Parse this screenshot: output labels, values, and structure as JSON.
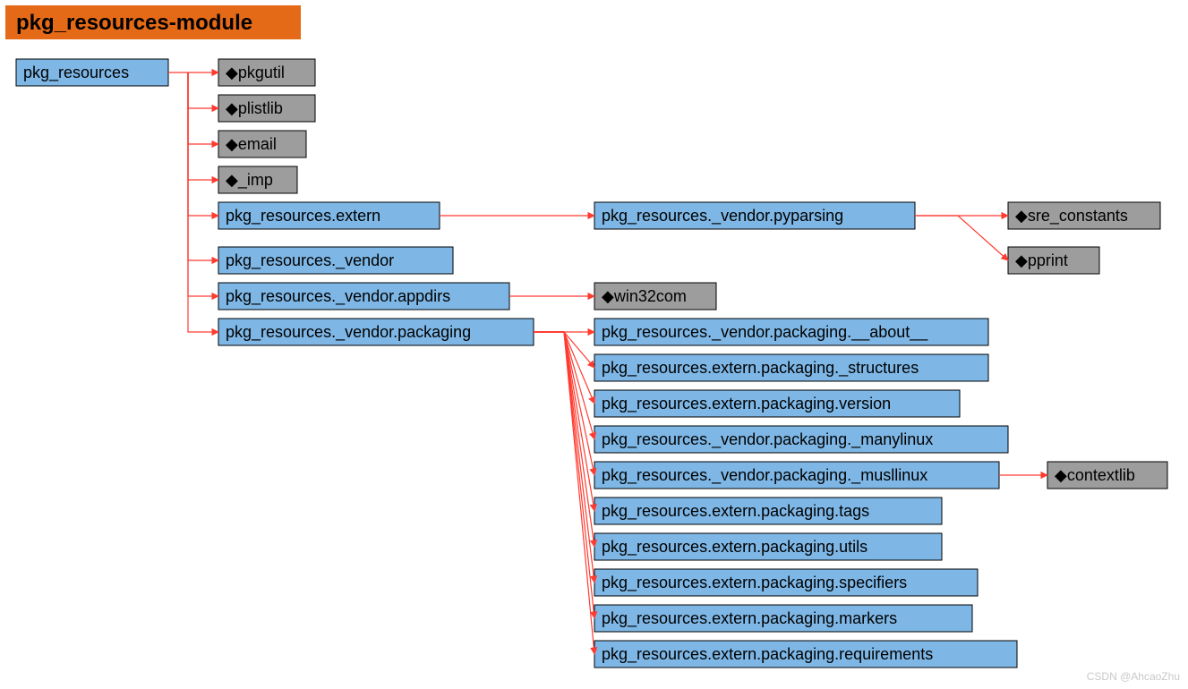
{
  "title": "pkg_resources-module",
  "watermark": "CSDN @AhcaoZhu",
  "nodes": {
    "root": "pkg_resources",
    "pkgutil": "◆pkgutil",
    "plistlib": "◆plistlib",
    "email": "◆email",
    "imp": "◆_imp",
    "extern": "pkg_resources.extern",
    "vendor": "pkg_resources._vendor",
    "vendor_appdirs": "pkg_resources._vendor.appdirs",
    "vendor_packaging": "pkg_resources._vendor.packaging",
    "vendor_pyparsing": "pkg_resources._vendor.pyparsing",
    "sre_constants": "◆sre_constants",
    "pprint": "◆pprint",
    "win32com": "◆win32com",
    "pkg_about": "pkg_resources._vendor.packaging.__about__",
    "pkg_structures": "pkg_resources.extern.packaging._structures",
    "pkg_version": "pkg_resources.extern.packaging.version",
    "pkg_manylinux": "pkg_resources._vendor.packaging._manylinux",
    "pkg_musllinux": "pkg_resources._vendor.packaging._musllinux",
    "pkg_tags": "pkg_resources.extern.packaging.tags",
    "pkg_utils": "pkg_resources.extern.packaging.utils",
    "pkg_specifiers": "pkg_resources.extern.packaging.specifiers",
    "pkg_markers": "pkg_resources.extern.packaging.markers",
    "pkg_requirements": "pkg_resources.extern.packaging.requirements",
    "contextlib": "◆contextlib"
  },
  "chart_data": {
    "type": "tree",
    "title": "pkg_resources-module",
    "edges": [
      [
        "pkg_resources",
        "pkgutil"
      ],
      [
        "pkg_resources",
        "plistlib"
      ],
      [
        "pkg_resources",
        "email"
      ],
      [
        "pkg_resources",
        "_imp"
      ],
      [
        "pkg_resources",
        "pkg_resources.extern"
      ],
      [
        "pkg_resources",
        "pkg_resources._vendor"
      ],
      [
        "pkg_resources",
        "pkg_resources._vendor.appdirs"
      ],
      [
        "pkg_resources",
        "pkg_resources._vendor.packaging"
      ],
      [
        "pkg_resources.extern",
        "pkg_resources._vendor.pyparsing"
      ],
      [
        "pkg_resources._vendor.pyparsing",
        "sre_constants"
      ],
      [
        "pkg_resources._vendor.pyparsing",
        "pprint"
      ],
      [
        "pkg_resources._vendor.appdirs",
        "win32com"
      ],
      [
        "pkg_resources._vendor.packaging",
        "pkg_resources._vendor.packaging.__about__"
      ],
      [
        "pkg_resources._vendor.packaging",
        "pkg_resources.extern.packaging._structures"
      ],
      [
        "pkg_resources._vendor.packaging",
        "pkg_resources.extern.packaging.version"
      ],
      [
        "pkg_resources._vendor.packaging",
        "pkg_resources._vendor.packaging._manylinux"
      ],
      [
        "pkg_resources._vendor.packaging",
        "pkg_resources._vendor.packaging._musllinux"
      ],
      [
        "pkg_resources._vendor.packaging",
        "pkg_resources.extern.packaging.tags"
      ],
      [
        "pkg_resources._vendor.packaging",
        "pkg_resources.extern.packaging.utils"
      ],
      [
        "pkg_resources._vendor.packaging",
        "pkg_resources.extern.packaging.specifiers"
      ],
      [
        "pkg_resources._vendor.packaging",
        "pkg_resources.extern.packaging.markers"
      ],
      [
        "pkg_resources._vendor.packaging",
        "pkg_resources.extern.packaging.requirements"
      ],
      [
        "pkg_resources._vendor.packaging._musllinux",
        "contextlib"
      ]
    ],
    "node_types": {
      "blue_package": [
        "pkg_resources",
        "pkg_resources.extern",
        "pkg_resources._vendor",
        "pkg_resources._vendor.appdirs",
        "pkg_resources._vendor.packaging",
        "pkg_resources._vendor.pyparsing",
        "pkg_resources._vendor.packaging.__about__",
        "pkg_resources.extern.packaging._structures",
        "pkg_resources.extern.packaging.version",
        "pkg_resources._vendor.packaging._manylinux",
        "pkg_resources._vendor.packaging._musllinux",
        "pkg_resources.extern.packaging.tags",
        "pkg_resources.extern.packaging.utils",
        "pkg_resources.extern.packaging.specifiers",
        "pkg_resources.extern.packaging.markers",
        "pkg_resources.extern.packaging.requirements"
      ],
      "grey_builtin": [
        "pkgutil",
        "plistlib",
        "email",
        "_imp",
        "sre_constants",
        "pprint",
        "win32com",
        "contextlib"
      ]
    }
  }
}
